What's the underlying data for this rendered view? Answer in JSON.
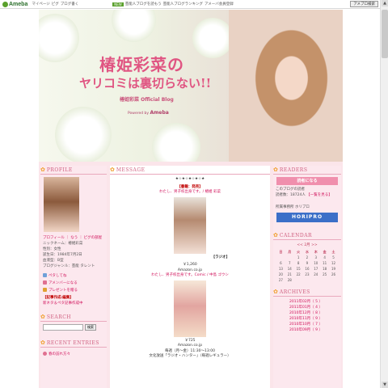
{
  "topbar": {
    "logo": "Ameba",
    "links": [
      "マイページ",
      "ピグ",
      "ブログ書く"
    ],
    "new_badge": "NEW",
    "notice": "芸能人ブログを読もう",
    "notice2": "芸能人ブログランキング",
    "notice3": "アメーバ会員登録",
    "button": "アメブロ検索"
  },
  "header": {
    "title_line1": "椿姫彩菜の",
    "title_line2": "ヤリコミは裏切らない!!",
    "subtitle": "椿姫彩菜 Official Blog",
    "powered_prefix": "Powered by",
    "powered_brand": "Ameba"
  },
  "left": {
    "profile_heading": "PROFILE",
    "profile_links": "プロフィール ｜ なう ｜ ピグの部屋",
    "profile_lines": [
      "ニックネーム：椿姫彩菜",
      "性別：女性",
      "誕生日：1984年7月2日",
      "血液型：B型",
      "ブログジャンル：芸能 タレント"
    ],
    "icon_links": [
      "ペタしてね",
      "アメンバーになる",
      "プレゼントを贈る"
    ],
    "reg_title": "【記事作成:編集】",
    "reg_sub": "新ネタ＆ペタ記事作成中",
    "search_heading": "SEARCH",
    "search_button": "検索",
    "recent_heading": "RECENT ENTRIES",
    "recent_first": "春の訪れ方々"
  },
  "center": {
    "message_heading": "MESSAGE",
    "stars": "★☆★☆★☆★☆★",
    "book1_tag": "【書籍：発売】",
    "book1_title": "わたし、男子校出身です。/ 椿姫 彩菜",
    "book1_caption": "【ラジオ】",
    "book1_price": "￥1,260",
    "book1_store": "Amazon.co.jp",
    "book2_title": "わたし、男子校出身です。Comic / 中島 ゴウシ",
    "book2_price": "￥725",
    "book2_store": "Amazon.co.jp",
    "radio_line1": "毎週（月〜金）11:30〜13:00",
    "radio_line2": "文化放送「ラジオ・ハンター」（毎週レギュラー）"
  },
  "right": {
    "readers_heading": "READERS",
    "reader_button": "読者になる",
    "reader_text": "このブログの読者",
    "reader_count": "読者数：18724人",
    "reader_list": "【一覧を見る】",
    "office_label": "所属事務所 ホリプロ",
    "horipro": "HORIPRO",
    "calendar_heading": "CALENDAR",
    "calendar_nav": "<< 2月 >>",
    "weekdays": [
      "日",
      "月",
      "火",
      "水",
      "木",
      "金",
      "土"
    ],
    "calendar_rows": [
      [
        "",
        "",
        "1",
        "2",
        "3",
        "4",
        "5"
      ],
      [
        "6",
        "7",
        "8",
        "9",
        "10",
        "11",
        "12"
      ],
      [
        "13",
        "14",
        "15",
        "16",
        "17",
        "18",
        "19"
      ],
      [
        "20",
        "21",
        "22",
        "23",
        "24",
        "25",
        "26"
      ],
      [
        "27",
        "28",
        "",
        "",
        "",
        "",
        ""
      ]
    ],
    "archives_heading": "ARCHIVES",
    "archives": [
      "2011年02月（ 5 ）",
      "2011年01月（ 4 ）",
      "2010年12月（ 8 ）",
      "2010年11月（ 9 ）",
      "2010年10月（ 7 ）",
      "2010年09月（ 9 ）"
    ]
  },
  "colors": {
    "accent": "#d06080",
    "link": "#d0105a",
    "page_bg": "#fbe5ea"
  }
}
